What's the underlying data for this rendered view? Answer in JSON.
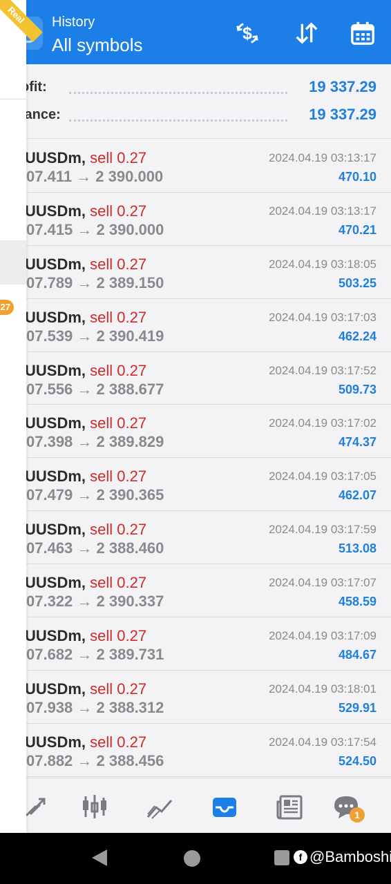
{
  "header": {
    "subtitle": "History",
    "title": "All symbols"
  },
  "summary": {
    "profit_label": "ofit:",
    "profit_value": "19 337.29",
    "balance_label": "lance:",
    "balance_value": "19 337.29"
  },
  "trades": [
    {
      "symbol": "UUSDm,",
      "side": "sell 0.27",
      "prices": "07.411 → 2 390.000",
      "time": "2024.04.19 03:13:17",
      "profit": "470.10"
    },
    {
      "symbol": "UUSDm,",
      "side": "sell 0.27",
      "prices": "07.415 → 2 390.000",
      "time": "2024.04.19 03:13:17",
      "profit": "470.21"
    },
    {
      "symbol": "UUSDm,",
      "side": "sell 0.27",
      "prices": "07.789 → 2 389.150",
      "time": "2024.04.19 03:18:05",
      "profit": "503.25"
    },
    {
      "symbol": "UUSDm,",
      "side": "sell 0.27",
      "prices": "07.539 → 2 390.419",
      "time": "2024.04.19 03:17:03",
      "profit": "462.24"
    },
    {
      "symbol": "UUSDm,",
      "side": "sell 0.27",
      "prices": "07.556 → 2 388.677",
      "time": "2024.04.19 03:17:52",
      "profit": "509.73"
    },
    {
      "symbol": "UUSDm,",
      "side": "sell 0.27",
      "prices": "07.398 → 2 389.829",
      "time": "2024.04.19 03:17:02",
      "profit": "474.37"
    },
    {
      "symbol": "UUSDm,",
      "side": "sell 0.27",
      "prices": "07.479 → 2 390.365",
      "time": "2024.04.19 03:17:05",
      "profit": "462.07"
    },
    {
      "symbol": "UUSDm,",
      "side": "sell 0.27",
      "prices": "07.463 → 2 388.460",
      "time": "2024.04.19 03:17:59",
      "profit": "513.08"
    },
    {
      "symbol": "UUSDm,",
      "side": "sell 0.27",
      "prices": "07.322 → 2 390.337",
      "time": "2024.04.19 03:17:07",
      "profit": "458.59"
    },
    {
      "symbol": "UUSDm,",
      "side": "sell 0.27",
      "prices": "07.682 → 2 389.731",
      "time": "2024.04.19 03:17:09",
      "profit": "484.67"
    },
    {
      "symbol": "UUSDm,",
      "side": "sell 0.27",
      "prices": "07.938 → 2 388.312",
      "time": "2024.04.19 03:18:01",
      "profit": "529.91"
    },
    {
      "symbol": "UUSDm,",
      "side": "sell 0.27",
      "prices": "07.882 → 2 388.456",
      "time": "2024.04.19 03:17:54",
      "profit": "524.50"
    }
  ],
  "bottom_nav": {
    "items": [
      "trade-icon",
      "candlestick-chart-icon",
      "trend-chart-icon",
      "history-inbox-icon",
      "news-icon",
      "chat-icon"
    ],
    "active": "history-inbox-icon",
    "chat_badge": "1"
  },
  "drawer": {
    "ribbon": "Real",
    "badge": "27"
  },
  "watermark": {
    "icon": "f",
    "text": "@Bamboshi"
  },
  "colors": {
    "header_bg": "#1c7fe8",
    "profit_blue": "#1f7fdc",
    "sell_red": "#cf2a2a",
    "badge_orange": "#f0a030",
    "ribbon_yellow": "#f2c230"
  }
}
